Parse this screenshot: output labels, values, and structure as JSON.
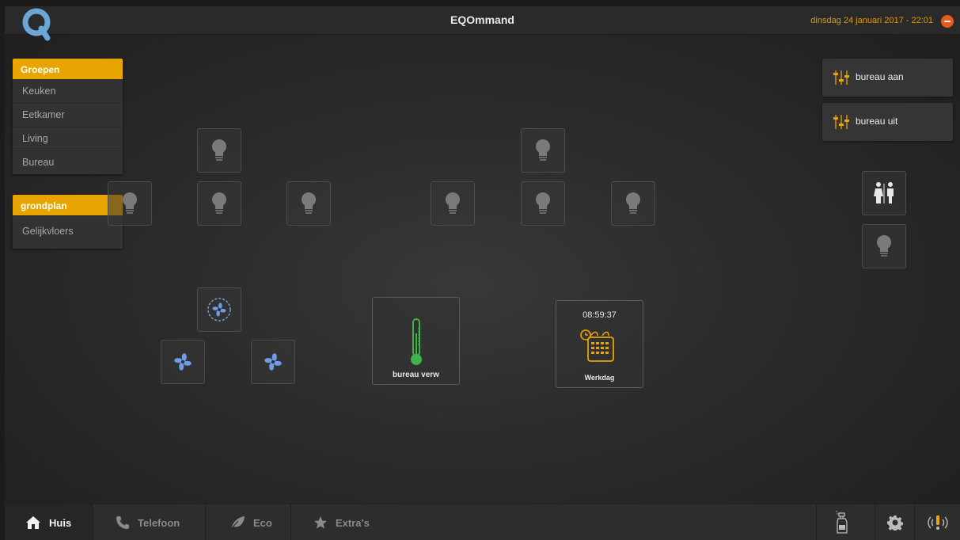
{
  "header": {
    "title": "EQOmmand",
    "datetime": "dinsdag 24 januari 2017 - 22:01"
  },
  "sidebar": {
    "groups_header": "Groepen",
    "groups": [
      "Keuken",
      "Eetkamer",
      "Living",
      "Bureau"
    ],
    "floorplan_header": "grondplan",
    "floorplans": [
      "Gelijkvloers"
    ]
  },
  "scenes": [
    {
      "label": "bureau aan",
      "icon": "sliders-icon"
    },
    {
      "label": "bureau uit",
      "icon": "sliders-icon"
    }
  ],
  "thermometer": {
    "label": "bureau verw",
    "icon": "thermometer-icon"
  },
  "timer": {
    "time": "08:59:37",
    "label": "Werkdag",
    "icon": "calendar-timer-icon"
  },
  "bottom_nav": [
    {
      "label": "Huis",
      "icon": "home-icon",
      "active": true
    },
    {
      "label": "Telefoon",
      "icon": "phone-icon",
      "active": false
    },
    {
      "label": "Eco",
      "icon": "leaf-icon",
      "active": false
    },
    {
      "label": "Extra's",
      "icon": "star-icon",
      "active": false
    }
  ],
  "utilities": [
    "cleaning-spray-icon",
    "settings-gear-icon",
    "alarm-icon"
  ],
  "colors": {
    "accent": "#e8a400",
    "fan_blue": "#6f9be8",
    "thermo_green": "#3cb44a",
    "close_red": "#e85b1a"
  }
}
